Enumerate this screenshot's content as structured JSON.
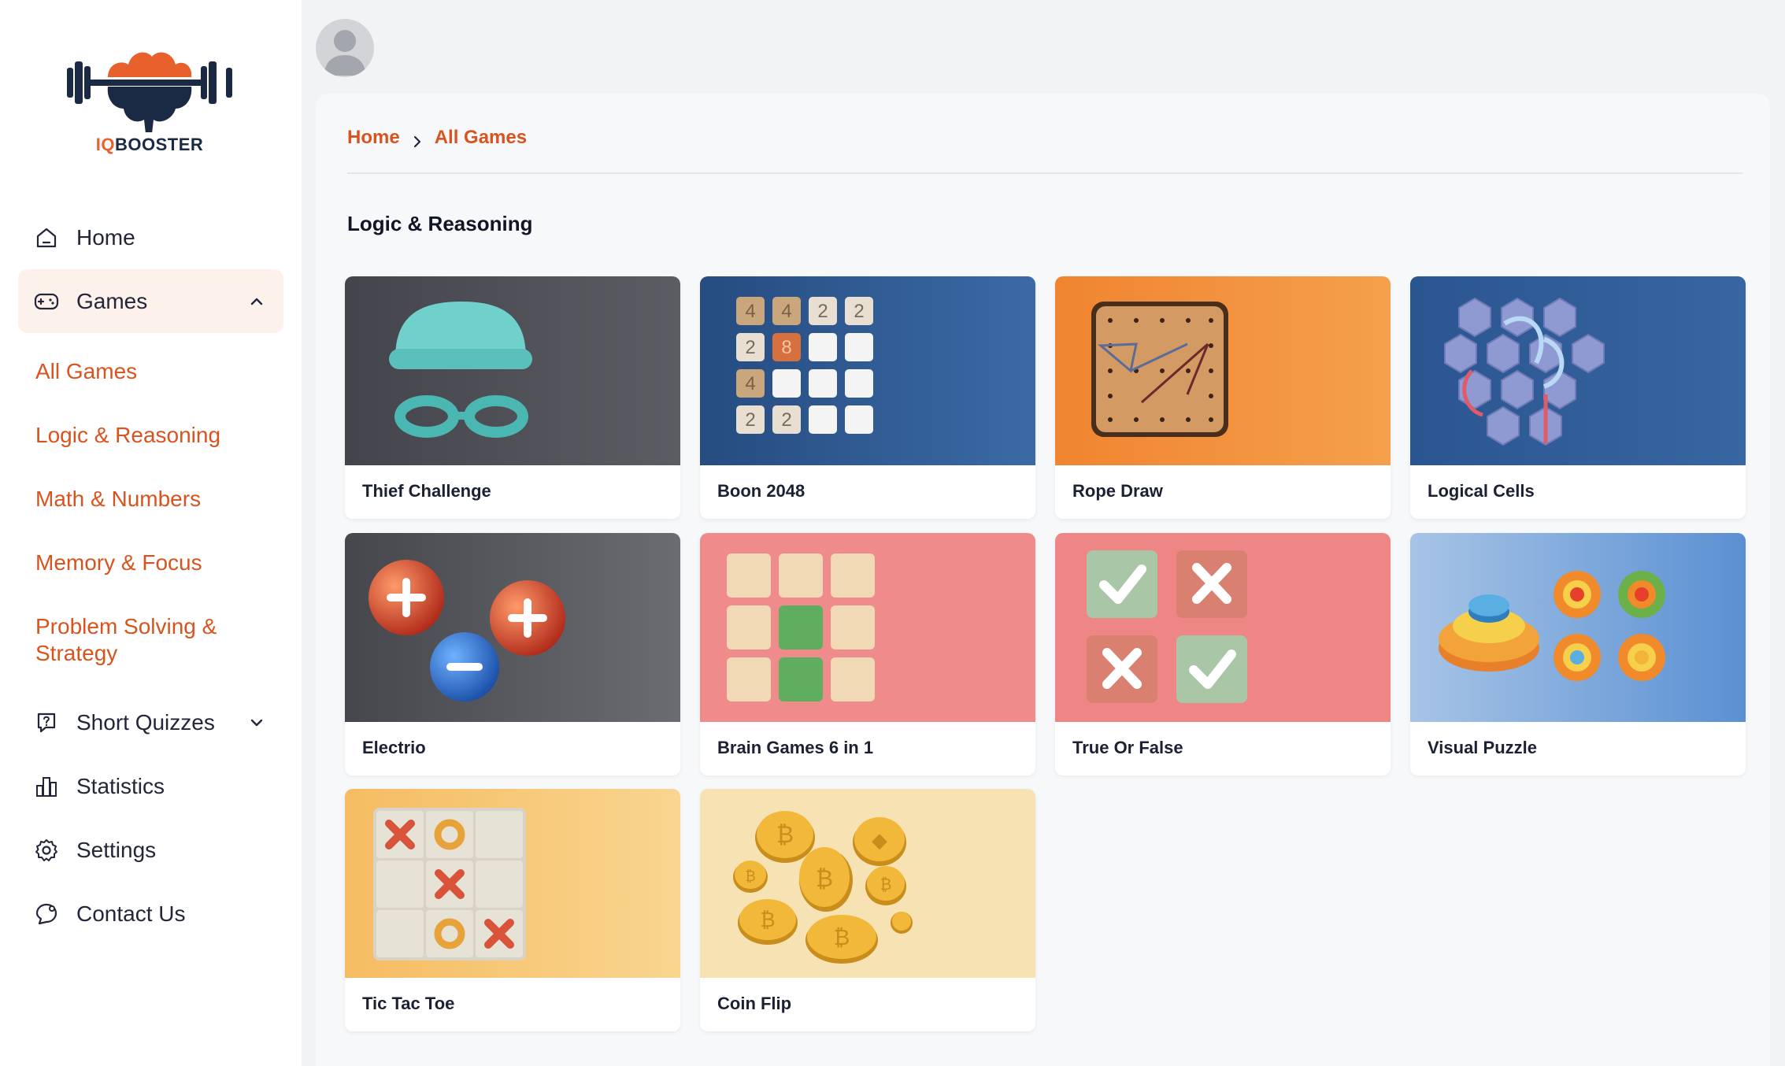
{
  "brand": {
    "prefix": "IQ",
    "suffix": "BOOSTER"
  },
  "sidebar": {
    "nav": [
      {
        "label": "Home",
        "icon": "home-icon"
      },
      {
        "label": "Games",
        "icon": "gamepad-icon"
      },
      {
        "label": "Short Quizzes",
        "icon": "quiz-icon"
      },
      {
        "label": "Statistics",
        "icon": "chart-bars-icon"
      },
      {
        "label": "Settings",
        "icon": "gear-icon"
      },
      {
        "label": "Contact Us",
        "icon": "chat-icon"
      }
    ],
    "games_submenu": [
      "All Games",
      "Logic & Reasoning",
      "Math & Numbers",
      "Memory & Focus",
      "Problem Solving & Strategy"
    ]
  },
  "breadcrumb": {
    "home": "Home",
    "current": "All Games"
  },
  "section_title": "Logic & Reasoning",
  "cards": [
    {
      "title": "Thief Challenge",
      "color": "#4a4a52"
    },
    {
      "title": "Boon 2048",
      "color": "#2f5a93",
      "tiles": [
        "4",
        "4",
        "2",
        "2",
        "2",
        "8",
        "4",
        "2",
        "2"
      ]
    },
    {
      "title": "Rope Draw",
      "color": "#f08a32"
    },
    {
      "title": "Logical Cells",
      "color": "#2c5b96"
    },
    {
      "title": "Electrio",
      "color": "#4d4f56"
    },
    {
      "title": "Brain Games 6 in 1",
      "color": "#ef8a8a"
    },
    {
      "title": "True Or False",
      "color": "#ee8585"
    },
    {
      "title": "Visual Puzzle",
      "color": "#8fb6e3"
    },
    {
      "title": "Tic Tac Toe",
      "color": "#f6c673"
    },
    {
      "title": "Coin Flip",
      "color": "#f6ddaa"
    }
  ],
  "colors": {
    "accent": "#d9531e",
    "active_bg": "#fdf1ec"
  }
}
